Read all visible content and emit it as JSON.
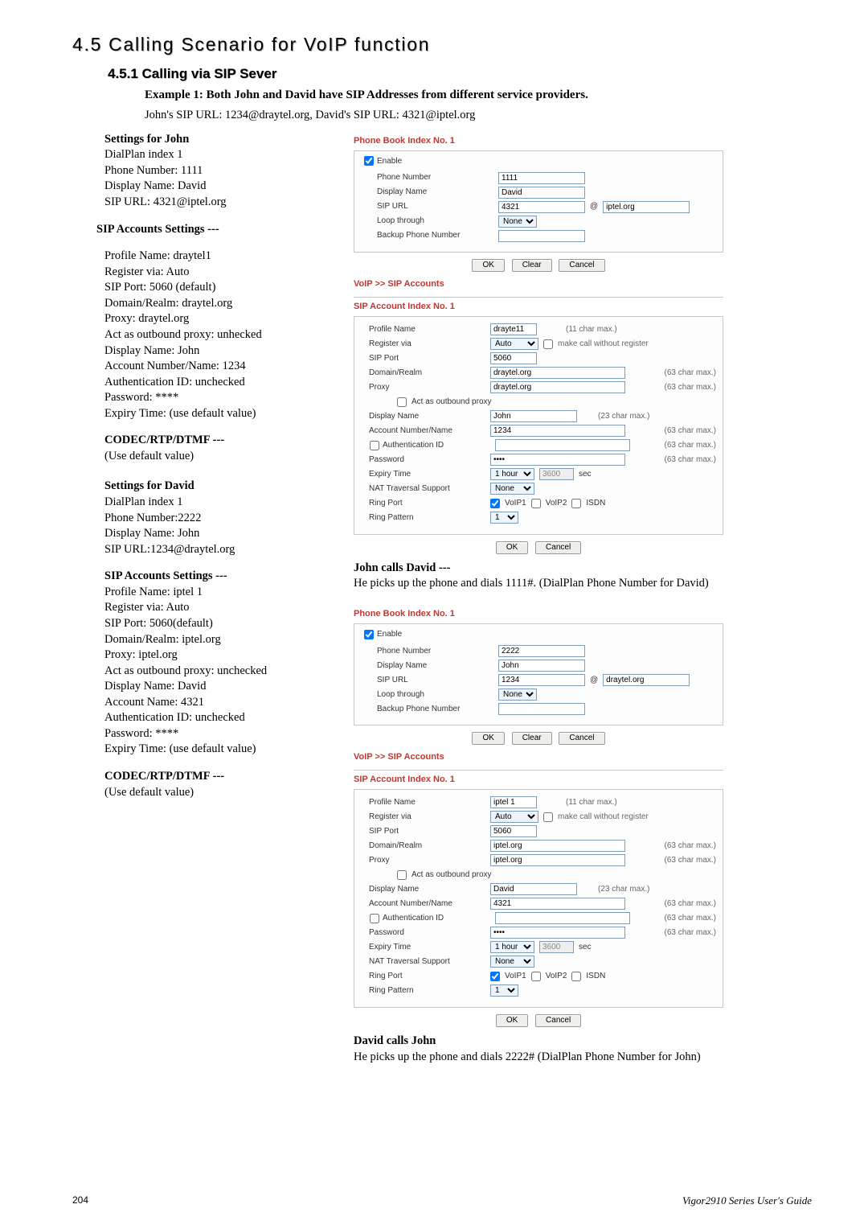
{
  "page": {
    "number": "204",
    "guide": "Vigor2910 Series User's Guide"
  },
  "heading": {
    "h2": "4.5 Calling Scenario for VoIP function",
    "h3": "4.5.1 Calling via SIP Sever",
    "example": "Example 1: Both John and David have SIP Addresses from different service providers.",
    "intro": "John's SIP URL: 1234@draytel.org, David's SIP URL: 4321@iptel.org"
  },
  "left": {
    "john_settings_title": "Settings for John",
    "john_settings": [
      "DialPlan index 1",
      "Phone Number: 1111",
      "Display Name: David",
      "SIP URL: 4321@iptel.org"
    ],
    "john_sip_title": "SIP Accounts Settings ---",
    "john_sip": [
      "Profile Name: draytel1",
      "Register via: Auto",
      "SIP Port: 5060 (default)",
      "Domain/Realm: draytel.org",
      "Proxy: draytel.org",
      "Act as outbound proxy: unhecked",
      "Display Name: John",
      "Account Number/Name: 1234",
      "Authentication ID: unchecked",
      "Password: ****",
      "Expiry Time: (use default value)"
    ],
    "john_codec_title": "CODEC/RTP/DTMF ---",
    "john_codec": "(Use default value)",
    "david_settings_title": "Settings for David",
    "david_settings": [
      "DialPlan index 1",
      "Phone Number:2222",
      "Display Name: John",
      "SIP URL:1234@draytel.org"
    ],
    "david_sip_title": "SIP Accounts Settings ---",
    "david_sip": [
      "Profile Name: iptel 1",
      "Register via: Auto",
      "SIP Port: 5060(default)",
      "Domain/Realm: iptel.org",
      "Proxy: iptel.org",
      "Act as outbound proxy: unchecked",
      "Display Name: David",
      "Account Name: 4321",
      "Authentication ID: unchecked",
      "Password: ****",
      "Expiry Time: (use default value)"
    ],
    "david_codec_title": "CODEC/RTP/DTMF ---",
    "david_codec": "(Use default value)"
  },
  "right_text": {
    "john_calls_title": "John calls David ---",
    "john_calls_body": "He picks up the phone and dials 1111#. (DialPlan Phone Number for David)",
    "david_calls_title": "David calls John",
    "david_calls_body": "He picks up the phone and dials 2222# (DialPlan Phone Number for John)"
  },
  "labels": {
    "phone_book_index": "Phone Book Index No. 1",
    "enable": "Enable",
    "phone_number": "Phone Number",
    "display_name": "Display Name",
    "sip_url": "SIP URL",
    "at": "@",
    "loop_through": "Loop through",
    "backup_phone_number": "Backup Phone Number",
    "ok": "OK",
    "clear": "Clear",
    "cancel": "Cancel",
    "voip_sip_accounts": "VoIP >> SIP Accounts",
    "sip_account_index": "SIP Account Index No. 1",
    "profile_name": "Profile Name",
    "register_via": "Register via",
    "make_call_wo": "make call without register",
    "sip_port": "SIP Port",
    "domain_realm": "Domain/Realm",
    "proxy": "Proxy",
    "act_outbound": "Act as outbound proxy",
    "account_num_name": "Account Number/Name",
    "auth_id": "Authentication ID",
    "password": "Password",
    "expiry_time": "Expiry Time",
    "nat_traversal": "NAT Traversal Support",
    "ring_port": "Ring Port",
    "ring_pattern": "Ring Pattern",
    "voip1": "VoIP1",
    "voip2": "VoIP2",
    "isdn": "ISDN",
    "sec": "sec",
    "h11": "(11 char max.)",
    "h23": "(23 char max.)",
    "h63": "(63 char max.)",
    "none": "None",
    "auto": "Auto",
    "one": "1",
    "one_hour": "1 hour",
    "expiry_val": "3600",
    "password_mask": "••••"
  },
  "form_john_pb": {
    "phone_number": "1111",
    "display_name": "David",
    "sip_url_user": "4321",
    "sip_url_domain": "iptel.org"
  },
  "form_john_sip": {
    "profile_name": "drayte11",
    "sip_port": "5060",
    "domain_realm": "draytel.org",
    "proxy": "draytel.org",
    "display_name": "John",
    "account": "1234"
  },
  "form_david_pb": {
    "phone_number": "2222",
    "display_name": "John",
    "sip_url_user": "1234",
    "sip_url_domain": "draytel.org"
  },
  "form_david_sip": {
    "profile_name": "iptel 1",
    "sip_port": "5060",
    "domain_realm": "iptel.org",
    "proxy": "iptel.org",
    "display_name": "David",
    "account": "4321"
  }
}
